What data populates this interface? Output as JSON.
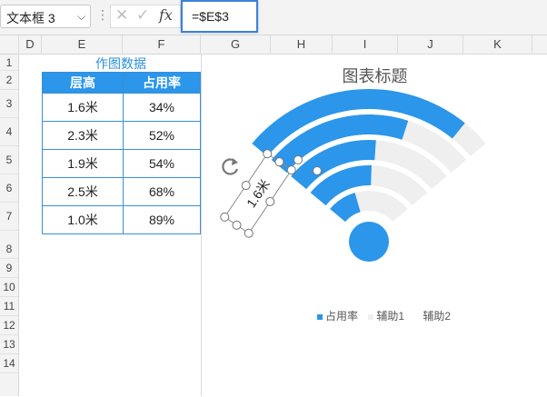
{
  "formula_bar": {
    "name_box": "文本框 3",
    "name_box_arrow": "⌵",
    "more": "⋮",
    "cancel": "✕",
    "confirm": "✓",
    "fx": "fx",
    "formula": "=$E$3"
  },
  "columns": [
    "D",
    "E",
    "F",
    "G",
    "H",
    "I",
    "J",
    "K"
  ],
  "rows": [
    "1",
    "2",
    "3",
    "4",
    "5",
    "6",
    "7",
    "8",
    "9",
    "10",
    "11",
    "12",
    "13",
    "14"
  ],
  "table": {
    "title": "作图数据",
    "headers": [
      "层高",
      "占用率"
    ],
    "rows": [
      [
        "1.6米",
        "34%"
      ],
      [
        "2.3米",
        "52%"
      ],
      [
        "1.9米",
        "54%"
      ],
      [
        "2.5米",
        "68%"
      ],
      [
        "1.0米",
        "89%"
      ]
    ]
  },
  "chart": {
    "title": "图表标题",
    "text_box": "1.6米",
    "legend": [
      {
        "name": "占用率",
        "color": "#2b96ea"
      },
      {
        "name": "辅助1",
        "color": "#f0f0f0"
      },
      {
        "name": "辅助2",
        "color": "#ffffff"
      }
    ],
    "colors": {
      "value": "#2b96ea",
      "track": "#efefef"
    }
  },
  "chart_data": {
    "type": "bar",
    "title": "图表标题",
    "categories": [
      "1.6米",
      "2.3米",
      "1.9米",
      "2.5米",
      "1.0米"
    ],
    "series": [
      {
        "name": "占用率",
        "values": [
          34,
          52,
          54,
          68,
          89
        ]
      }
    ],
    "legend_position": "bottom"
  }
}
